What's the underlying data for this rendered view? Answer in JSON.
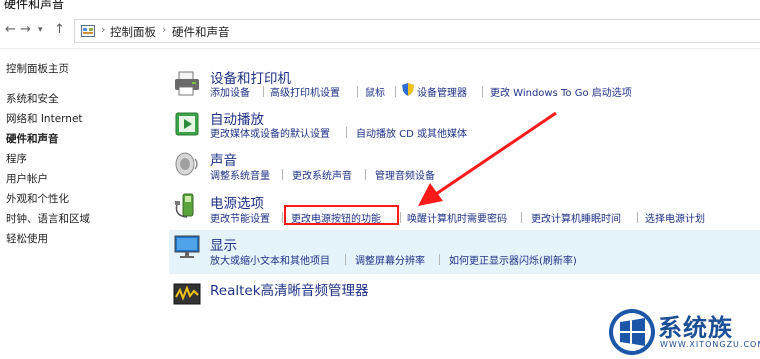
{
  "window": {
    "title": "硬件和声音"
  },
  "address_bar": {
    "root": "控制面板",
    "current": "硬件和声音"
  },
  "left_nav": [
    {
      "label": "控制面板主页",
      "active": false
    },
    {
      "label": "系统和安全",
      "active": false
    },
    {
      "label": "网络和 Internet",
      "active": false
    },
    {
      "label": "硬件和声音",
      "active": true
    },
    {
      "label": "程序",
      "active": false
    },
    {
      "label": "用户帐户",
      "active": false
    },
    {
      "label": "外观和个性化",
      "active": false
    },
    {
      "label": "时钟、语言和区域",
      "active": false
    },
    {
      "label": "轻松使用",
      "active": false
    }
  ],
  "categories": {
    "devices": {
      "title": "设备和打印机",
      "icon": "printer-icon",
      "links": [
        "添加设备",
        "高级打印机设置",
        "鼠标",
        "设备管理器",
        "更改 Windows To Go 启动选项"
      ]
    },
    "autoplay": {
      "title": "自动播放",
      "icon": "autoplay-icon",
      "links": [
        "更改媒体或设备的默认设置",
        "自动播放 CD 或其他媒体"
      ]
    },
    "sound": {
      "title": "声音",
      "icon": "speaker-icon",
      "links": [
        "调整系统音量",
        "更改系统声音",
        "管理音频设备"
      ]
    },
    "power": {
      "title": "电源选项",
      "icon": "power-options-icon",
      "links": [
        "更改节能设置",
        "更改电源按钮的功能",
        "唤醒计算机时需要密码",
        "更改计算机睡眠时间",
        "选择电源计划"
      ]
    },
    "display": {
      "title": "显示",
      "icon": "monitor-icon",
      "links": [
        "放大或缩小文本和其他项目",
        "调整屏幕分辨率",
        "如何更正显示器闪烁(刷新率)"
      ]
    },
    "realtek": {
      "title": "Realtek高清晰音频管理器",
      "icon": "realtek-audio-icon"
    }
  },
  "watermark": {
    "brand": "系统族",
    "url": "WWW.XITONGZU.COM"
  },
  "colors": {
    "link": "#1e3287",
    "highlight": "#e5f3fb",
    "annotation": "#ff1a1a"
  }
}
